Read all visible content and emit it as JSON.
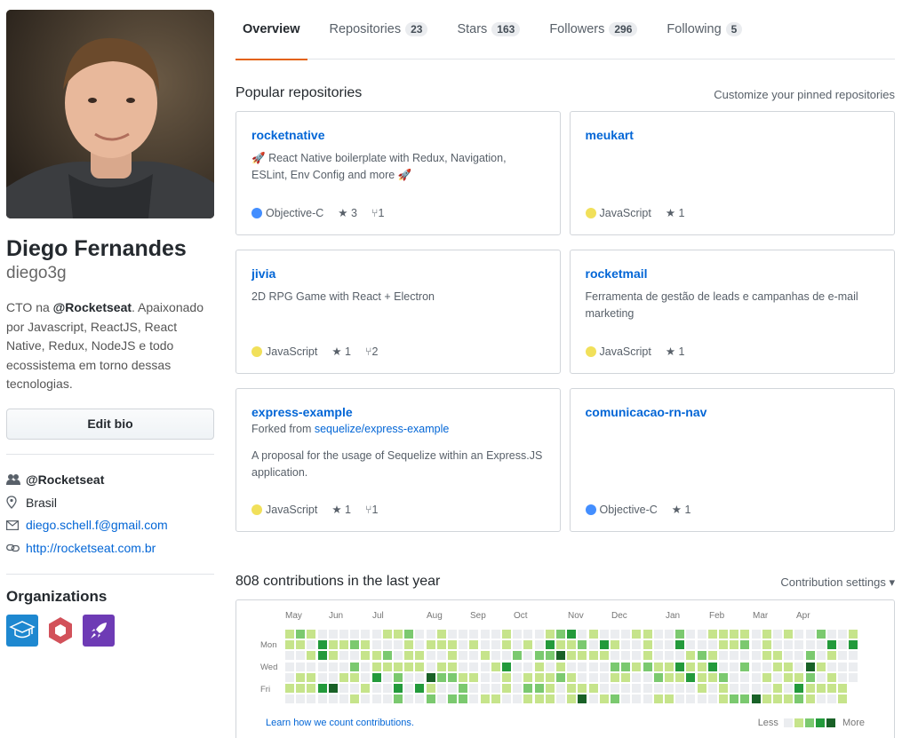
{
  "profile": {
    "full_name": "Diego Fernandes",
    "login": "diego3g",
    "bio_prefix": "CTO na ",
    "bio_org": "@Rocketseat",
    "bio_rest": ". Apaixonado por Javascript, ReactJS, React Native, Redux, NodeJS e todo ecossistema em torno dessas tecnologias.",
    "edit_bio_label": "Edit bio",
    "company": "@Rocketseat",
    "location": "Brasil",
    "email": "diego.schell.f@gmail.com",
    "website": "http://rocketseat.com.br",
    "orgs_title": "Organizations"
  },
  "tabs": [
    {
      "label": "Overview",
      "count": ""
    },
    {
      "label": "Repositories",
      "count": "23"
    },
    {
      "label": "Stars",
      "count": "163"
    },
    {
      "label": "Followers",
      "count": "296"
    },
    {
      "label": "Following",
      "count": "5"
    }
  ],
  "pinned": {
    "title": "Popular repositories",
    "customize": "Customize your pinned repositories",
    "repos": [
      {
        "name": "rocketnative",
        "forked_prefix": "",
        "forked_from": "",
        "description": "React Native boilerplate with Redux, Navigation, ESLint, Env Config and more",
        "language": "Objective-C",
        "lang_color": "#438eff",
        "stars": "3",
        "forks": "1"
      },
      {
        "name": "meukart",
        "forked_prefix": "",
        "forked_from": "",
        "description": "",
        "language": "JavaScript",
        "lang_color": "#f1e05a",
        "stars": "1",
        "forks": ""
      },
      {
        "name": "jivia",
        "forked_prefix": "",
        "forked_from": "",
        "description": "2D RPG Game with React + Electron",
        "language": "JavaScript",
        "lang_color": "#f1e05a",
        "stars": "1",
        "forks": "2"
      },
      {
        "name": "rocketmail",
        "forked_prefix": "",
        "forked_from": "",
        "description": "Ferramenta de gestão de leads e campanhas de e-mail marketing",
        "language": "JavaScript",
        "lang_color": "#f1e05a",
        "stars": "1",
        "forks": ""
      },
      {
        "name": "express-example",
        "forked_prefix": "Forked from ",
        "forked_from": "sequelize/express-example",
        "description": "A proposal for the usage of Sequelize within an Express.JS application.",
        "language": "JavaScript",
        "lang_color": "#f1e05a",
        "stars": "1",
        "forks": "1"
      },
      {
        "name": "comunicacao-rn-nav",
        "forked_prefix": "",
        "forked_from": "",
        "description": "",
        "language": "Objective-C",
        "lang_color": "#438eff",
        "stars": "1",
        "forks": ""
      }
    ]
  },
  "contributions": {
    "title": "808 contributions in the last year",
    "settings": "Contribution settings ▾",
    "months": [
      "May",
      "Jun",
      "Jul",
      "Aug",
      "Sep",
      "Oct",
      "Nov",
      "Dec",
      "Jan",
      "Feb",
      "Mar",
      "Apr"
    ],
    "days": [
      "Mon",
      "Wed",
      "Fri"
    ],
    "learn": "Learn how we count contributions.",
    "less": "Less",
    "more": "More",
    "colors": [
      "#ebedf0",
      "#c6e48b",
      "#7bc96f",
      "#239a3b",
      "#196127"
    ]
  }
}
